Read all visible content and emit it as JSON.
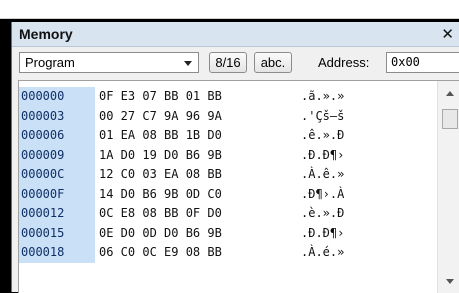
{
  "memory_panel": {
    "title": "Memory",
    "close_glyph": "✕",
    "space_select": {
      "value": "Program"
    },
    "format_button": "8/16",
    "ascii_button": "abc.",
    "address_label": "Address:",
    "address_value": "0x00"
  },
  "rows": [
    {
      "addr": "000000",
      "bytes": "0F E3 07 BB 01 BB",
      "ascii": ".ã.».»"
    },
    {
      "addr": "000003",
      "bytes": "00 27 C7 9A 96 9A",
      "ascii": ".'Çš–š"
    },
    {
      "addr": "000006",
      "bytes": "01 EA 08 BB 1B D0",
      "ascii": ".ê.».Đ"
    },
    {
      "addr": "000009",
      "bytes": "1A D0 19 D0 B6 9B",
      "ascii": ".Đ.Đ¶›"
    },
    {
      "addr": "00000C",
      "bytes": "12 C0 03 EA 08 BB",
      "ascii": ".À.ê.»"
    },
    {
      "addr": "00000F",
      "bytes": "14 D0 B6 9B 0D C0",
      "ascii": ".Đ¶›.À"
    },
    {
      "addr": "000012",
      "bytes": "0C E8 08 BB 0F D0",
      "ascii": ".è.».Đ"
    },
    {
      "addr": "000015",
      "bytes": "0E D0 0D D0 B6 9B",
      "ascii": ".Đ.Đ¶›"
    },
    {
      "addr": "000018",
      "bytes": "06 C0 0C E9 08 BB",
      "ascii": ".À.é.»"
    }
  ]
}
